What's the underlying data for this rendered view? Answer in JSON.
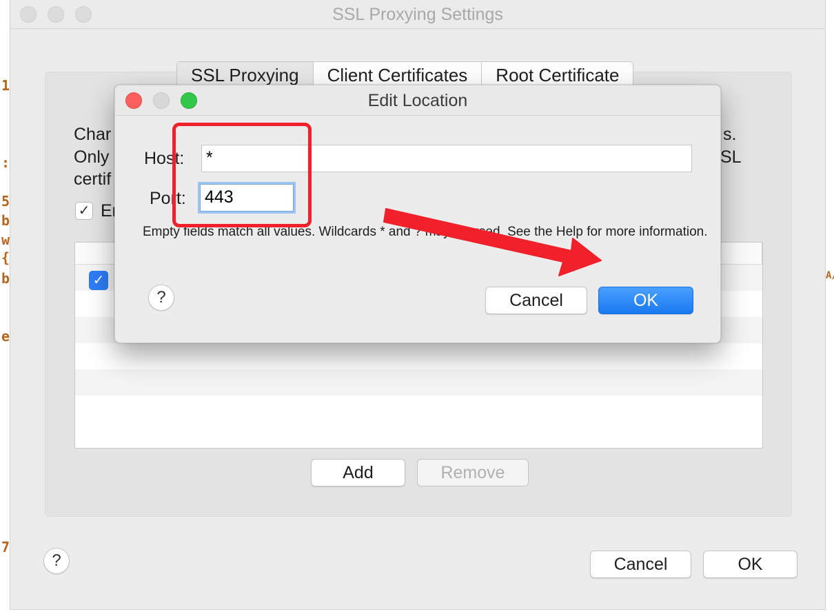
{
  "background_code": {
    "left_chars": [
      "1",
      ":",
      "5",
      "b",
      "w",
      "{",
      "b",
      "e",
      "7"
    ],
    "right_chars": [
      "A/"
    ]
  },
  "window": {
    "title": "SSL Proxying Settings"
  },
  "tabs": [
    {
      "label": "SSL Proxying",
      "active": true
    },
    {
      "label": "Client Certificates",
      "active": false
    },
    {
      "label": "Root Certificate",
      "active": false
    }
  ],
  "description": {
    "line1_left": "Char",
    "line1_right": "s.",
    "line2_left": "Only",
    "line2_right": "SL",
    "line3_left": "certif"
  },
  "enable_checkbox": {
    "checked": true,
    "label": "Er"
  },
  "table": {
    "rows": [
      {
        "checked": true
      }
    ]
  },
  "panel_buttons": {
    "add": "Add",
    "remove": "Remove"
  },
  "footer_buttons": {
    "help": "?",
    "cancel": "Cancel",
    "ok": "OK"
  },
  "edit_location": {
    "title": "Edit Location",
    "host_label": "Host:",
    "host_value": "*",
    "port_label": "Port:",
    "port_value": "443",
    "hint": "Empty fields match all values. Wildcards * and ? may be used. See the Help for more information.",
    "help": "?",
    "cancel": "Cancel",
    "ok": "OK"
  },
  "colors": {
    "annotation_red": "#f0212b",
    "primary_blue": "#1979f0",
    "checkbox_blue": "#2e7cf6"
  }
}
